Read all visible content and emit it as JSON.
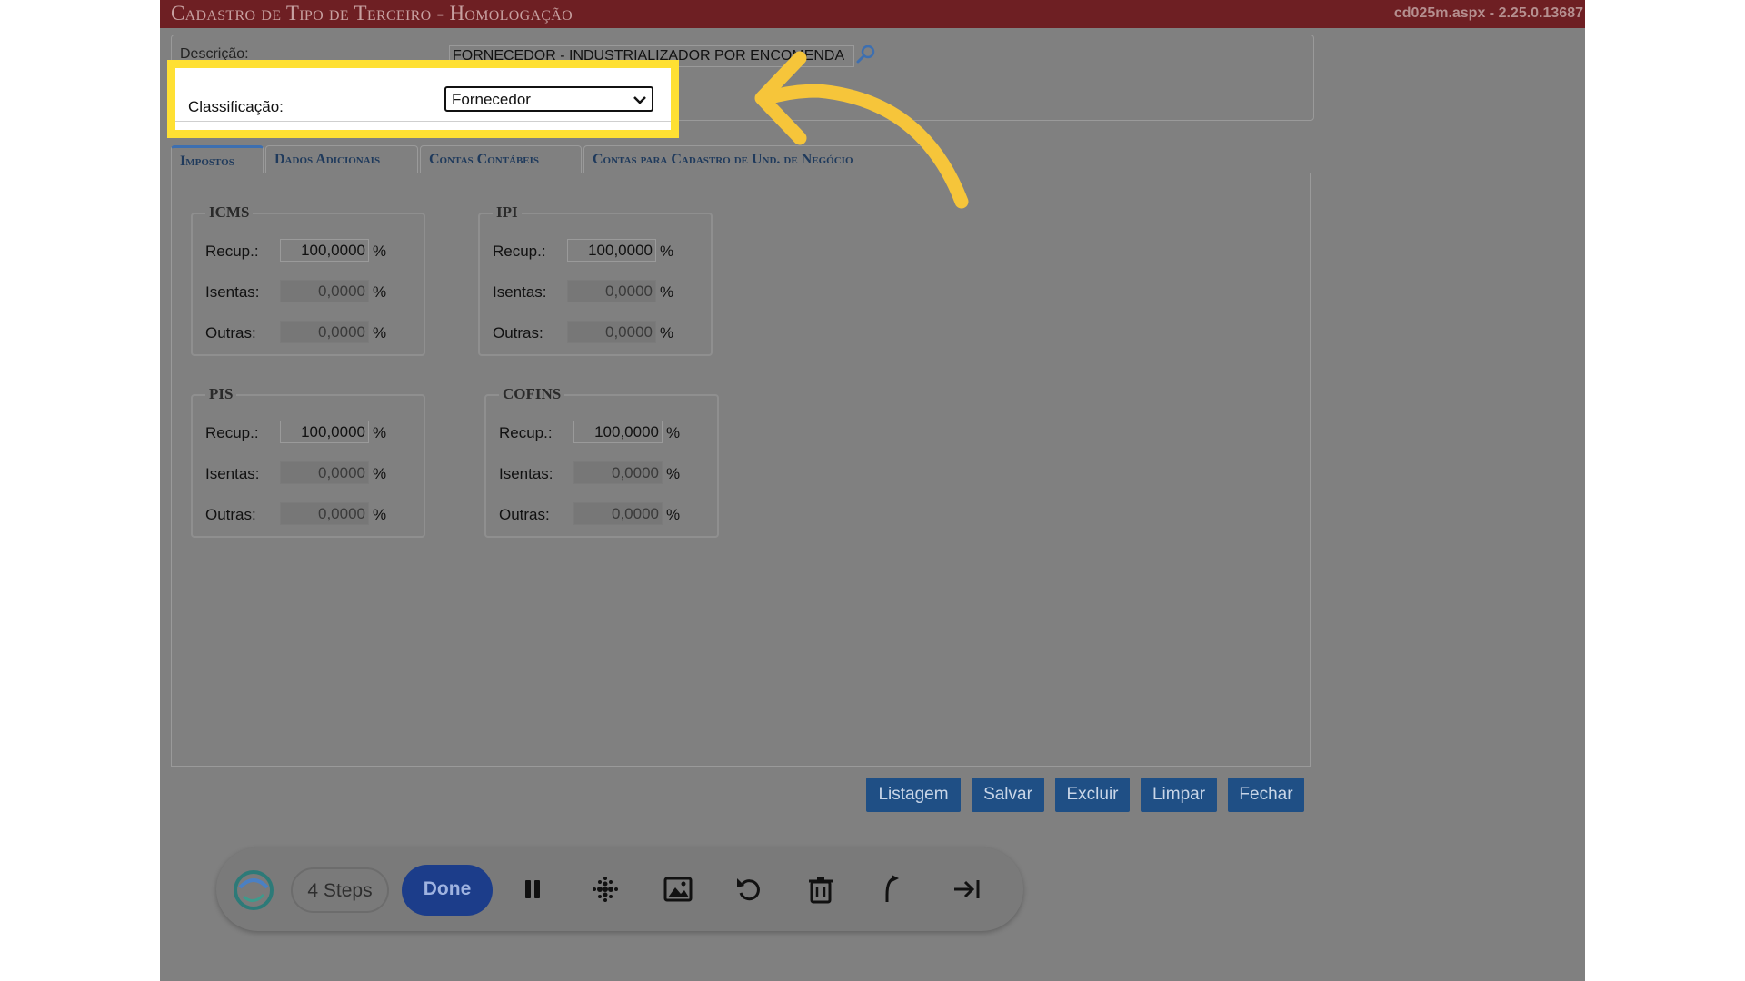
{
  "window": {
    "title": "Cadastro de Tipo de Terceiro  - Homologação",
    "version": "cd025m.aspx - 2.25.0.13687"
  },
  "header": {
    "description_label": "Descrição:",
    "description_value": "FORNECEDOR - INDUSTRIALIZADOR POR ENCOMENDA",
    "classification_label": "Classificação:",
    "classification_value": "Fornecedor"
  },
  "tabs": [
    {
      "label": "Impostos",
      "active": true
    },
    {
      "label": "Dados Adicionais",
      "active": false
    },
    {
      "label": "Contas Contábeis",
      "active": false
    },
    {
      "label": "Contas para Cadastro de Und. de Negócio",
      "active": false
    }
  ],
  "taxes": {
    "icms": {
      "legend": "ICMS",
      "recup_label": "Recup.:",
      "recup": "100,0000",
      "isentas_label": "Isentas:",
      "isentas": "0,0000",
      "outras_label": "Outras:",
      "outras": "0,0000",
      "unit": "%"
    },
    "ipi": {
      "legend": "IPI",
      "recup_label": "Recup.:",
      "recup": "100,0000",
      "isentas_label": "Isentas:",
      "isentas": "0,0000",
      "outras_label": "Outras:",
      "outras": "0,0000",
      "unit": "%"
    },
    "pis": {
      "legend": "PIS",
      "recup_label": "Recup.:",
      "recup": "100,0000",
      "isentas_label": "Isentas:",
      "isentas": "0,0000",
      "outras_label": "Outras:",
      "outras": "0,0000",
      "unit": "%"
    },
    "cofins": {
      "legend": "COFINS",
      "recup_label": "Recup.:",
      "recup": "100,0000",
      "isentas_label": "Isentas:",
      "isentas": "0,0000",
      "outras_label": "Outras:",
      "outras": "0,0000",
      "unit": "%"
    }
  },
  "actions": {
    "listagem": "Listagem",
    "salvar": "Salvar",
    "excluir": "Excluir",
    "limpar": "Limpar",
    "fechar": "Fechar"
  },
  "recorder": {
    "steps": "4 Steps",
    "done": "Done",
    "icons": [
      "logo-icon",
      "pause-icon",
      "blur-icon",
      "image-icon",
      "undo-icon",
      "trash-icon",
      "branch-icon",
      "skip-to-end-icon"
    ]
  },
  "colors": {
    "title_bar": "#6e1f23",
    "highlight": "#ffe033",
    "button": "#1f4f85",
    "done_button": "#1c3d8a"
  }
}
